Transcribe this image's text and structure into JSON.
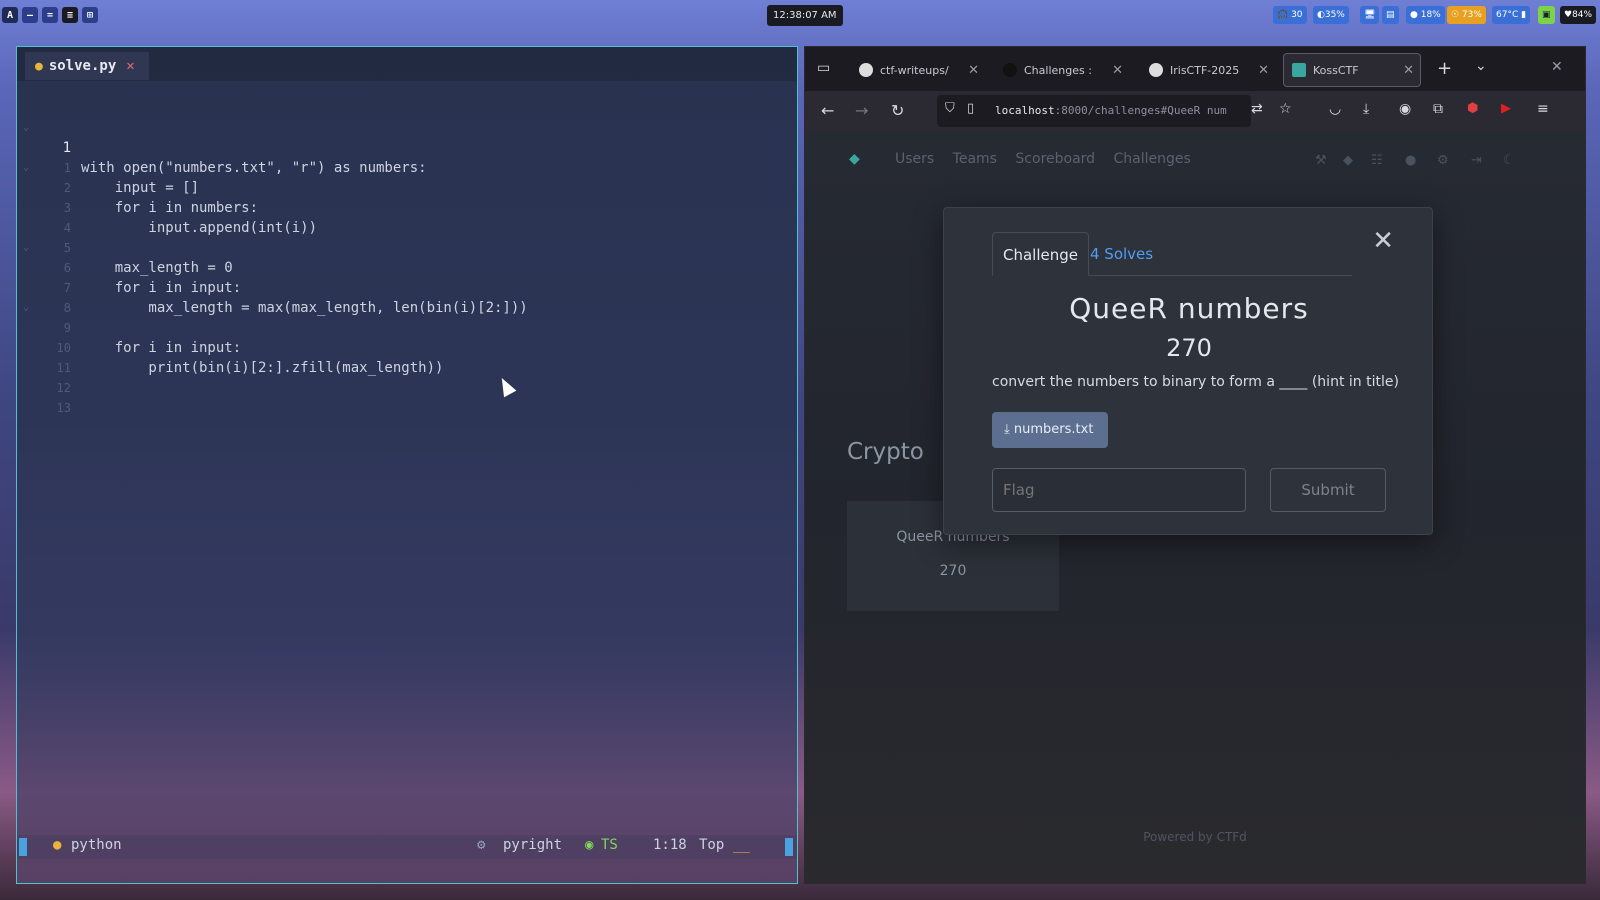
{
  "topbar": {
    "clock": "12:38:07 AM",
    "tray": [
      {
        "label": "🎧 30"
      },
      {
        "label": "◐35%"
      },
      {
        "label": "🖥"
      },
      {
        "label": "▤"
      },
      {
        "label": "● 18%"
      },
      {
        "label": "☉ 73%"
      },
      {
        "label": "67°C ▮"
      },
      {
        "label": "▣"
      },
      {
        "label": "♥84%"
      }
    ]
  },
  "editor": {
    "tab_name": "solve.py",
    "tab_close": "✕",
    "lines": [
      {
        "num": "1",
        "fold": "⌄"
      },
      {
        "num": "1",
        "fold": ""
      },
      {
        "num": "2",
        "fold": "⌄"
      },
      {
        "num": "3",
        "fold": ""
      },
      {
        "num": "4",
        "fold": ""
      },
      {
        "num": "5",
        "fold": ""
      },
      {
        "num": "6",
        "fold": "⌄"
      },
      {
        "num": "7",
        "fold": ""
      },
      {
        "num": "8",
        "fold": ""
      },
      {
        "num": "9",
        "fold": "⌄"
      },
      {
        "num": "10",
        "fold": ""
      },
      {
        "num": "11",
        "fold": ""
      },
      {
        "num": "12",
        "fold": ""
      },
      {
        "num": "13",
        "fold": ""
      }
    ],
    "code": [
      "with open(\"numbers.txt\", \"r\") as numbers:",
      "    input = []",
      "    for i in numbers:",
      "        input.append(int(i))",
      "",
      "    max_length = 0",
      "    for i in input:",
      "        max_length = max(max_length, len(bin(i)[2:]))",
      "",
      "    for i in input:",
      "        print(bin(i)[2:].zfill(max_length))",
      "",
      "",
      ""
    ],
    "status": {
      "filetype": "python",
      "lsp": "pyright",
      "ts": "TS",
      "position": "1:18",
      "scroll": "Top",
      "extra": "__"
    }
  },
  "browser": {
    "tabs": [
      {
        "label": "ctf-writeups/",
        "close": "✕"
      },
      {
        "label": "Challenges :",
        "close": "✕"
      },
      {
        "label": "IrisCTF-2025",
        "close": "✕"
      },
      {
        "label": "KossCTF",
        "close": "✕"
      }
    ],
    "new_tab": "+",
    "tab_list": "⌄",
    "window_close": "✕",
    "url_host": "localhost",
    "url_rest": ":8000/challenges#QueeR num",
    "page_nav": [
      "Users",
      "Teams",
      "Scoreboard",
      "Challenges"
    ],
    "category": "Crypto",
    "card": {
      "title": "QueeR numbers",
      "points": "270"
    },
    "footer": "Powered by CTFd",
    "modal": {
      "tab_challenge": "Challenge",
      "tab_solves": "4 Solves",
      "close": "✕",
      "title": "QueeR numbers",
      "points": "270",
      "description": "convert the numbers to binary to form a ____ (hint in title)",
      "file_label": "numbers.txt",
      "flag_placeholder": "Flag",
      "submit_label": "Submit"
    }
  }
}
